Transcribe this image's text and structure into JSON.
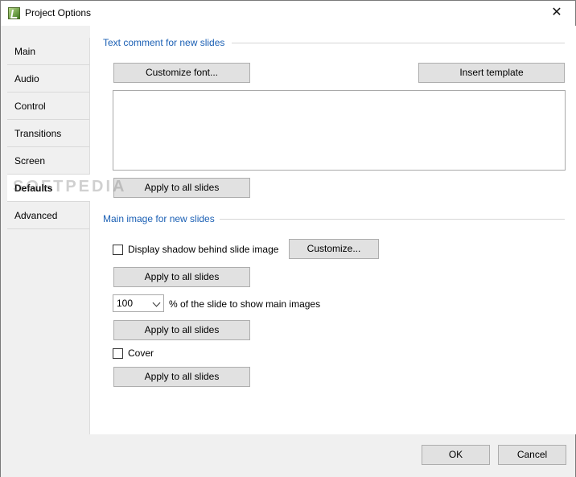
{
  "window": {
    "title": "Project Options",
    "close_glyph": "✕"
  },
  "sidebar": {
    "items": [
      {
        "label": "Main"
      },
      {
        "label": "Audio"
      },
      {
        "label": "Control"
      },
      {
        "label": "Transitions"
      },
      {
        "label": "Screen"
      },
      {
        "label": "Defaults",
        "active": true
      },
      {
        "label": "Advanced"
      }
    ]
  },
  "text_comment": {
    "group_label": "Text comment for new slides",
    "customize_font_label": "Customize font...",
    "insert_template_label": "Insert template",
    "comment_value": "",
    "apply_label": "Apply to all slides"
  },
  "main_image": {
    "group_label": "Main image for new slides",
    "shadow_label": "Display shadow behind slide image",
    "shadow_checked": false,
    "customize_label": "Customize...",
    "apply_shadow_label": "Apply to all slides",
    "size_value": "100",
    "size_suffix": "% of the slide to show main images",
    "apply_size_label": "Apply to all slides",
    "cover_label": "Cover",
    "cover_checked": false,
    "apply_cover_label": "Apply to all slides"
  },
  "footer": {
    "ok_label": "OK",
    "cancel_label": "Cancel"
  },
  "watermark": "SOFTPEDIA"
}
